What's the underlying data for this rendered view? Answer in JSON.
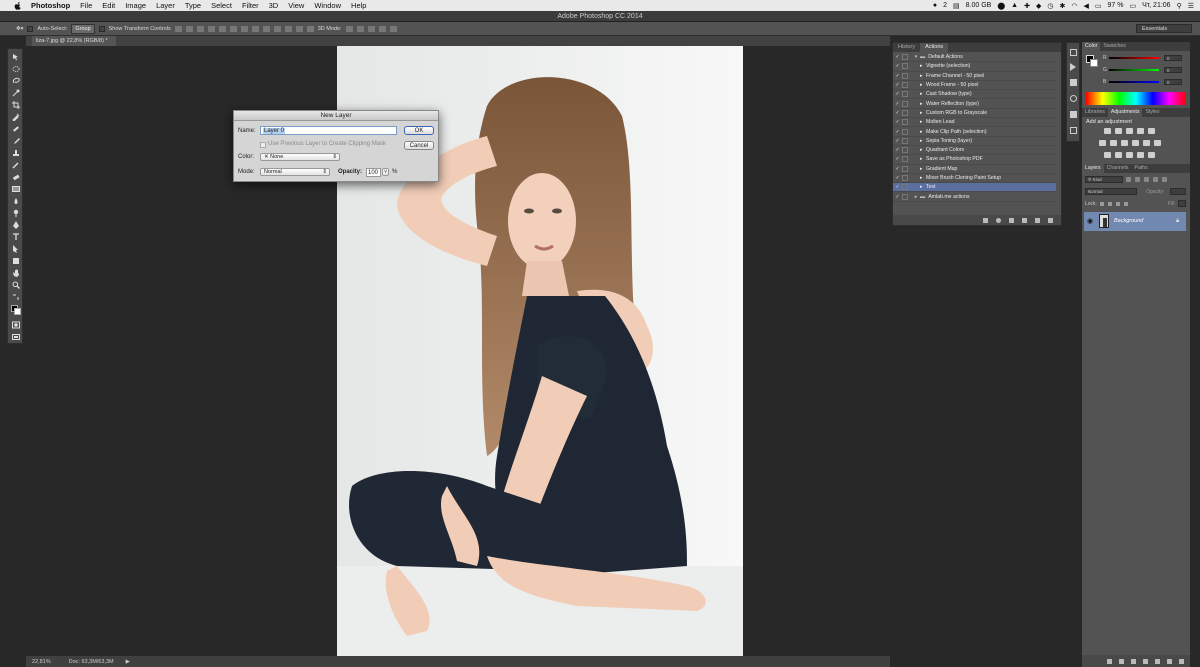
{
  "menubar": {
    "app": "Photoshop",
    "items": [
      "File",
      "Edit",
      "Image",
      "Layer",
      "Type",
      "Select",
      "Filter",
      "3D",
      "View",
      "Window",
      "Help"
    ],
    "status": {
      "notif": "2",
      "memory": "8.00 GB",
      "battery": "97 %",
      "clock": "Чт, 21:06"
    }
  },
  "window_title": "Adobe Photoshop CC 2014",
  "options_bar": {
    "auto_select_label": "Auto-Select:",
    "auto_select_value": "Group",
    "show_transform": "Show Transform Controls",
    "mode_3d": "3D Mode:",
    "workspace": "Essentials"
  },
  "document_tab": "liza-7.jpg @ 22,8% (RGB/8) *",
  "status_bar": {
    "zoom": "22,81%",
    "doc": "Doc: 63,3M/63,3M"
  },
  "dialog": {
    "title": "New Layer",
    "name_label": "Name:",
    "name_value": "Layer 0",
    "clip_label": "Use Previous Layer to Create Clipping Mask",
    "color_label": "Color:",
    "color_value": "None",
    "mode_label": "Mode:",
    "mode_value": "Normal",
    "opacity_label": "Opacity:",
    "opacity_value": "100",
    "opacity_unit": "%",
    "ok": "OK",
    "cancel": "Cancel"
  },
  "actions_panel": {
    "tabs": [
      "History",
      "Actions"
    ],
    "active_tab": "Actions",
    "rows": [
      {
        "label": "Default Actions",
        "folder": true,
        "open": true
      },
      {
        "label": "Vignette (selection)"
      },
      {
        "label": "Frame Channel - 50 pixel"
      },
      {
        "label": "Wood Frame - 50 pixel"
      },
      {
        "label": "Cast Shadow (type)"
      },
      {
        "label": "Water Reflection (type)"
      },
      {
        "label": "Custom RGB to Grayscale"
      },
      {
        "label": "Molten Lead"
      },
      {
        "label": "Make Clip Path (selection)"
      },
      {
        "label": "Sepia Toning (layer)"
      },
      {
        "label": "Quadrant Colors"
      },
      {
        "label": "Save as Photoshop PDF"
      },
      {
        "label": "Gradient Map"
      },
      {
        "label": "Mixer Brush Cloning Paint Setup"
      },
      {
        "label": "Test",
        "selected": true
      },
      {
        "label": "Amlab.me actions",
        "folder": true
      }
    ]
  },
  "color_panel": {
    "tabs": [
      "Color",
      "Swatches"
    ],
    "channels": [
      {
        "label": "R",
        "value": "0"
      },
      {
        "label": "G",
        "value": "0"
      },
      {
        "label": "B",
        "value": "0"
      }
    ]
  },
  "adjustments_panel": {
    "tabs": [
      "Libraries",
      "Adjustments",
      "Styles"
    ],
    "heading": "Add an adjustment"
  },
  "layers_panel": {
    "tabs": [
      "Layers",
      "Channels",
      "Paths"
    ],
    "kind_filter": "Kind",
    "blend_mode": "Normal",
    "opacity_label": "Opacity:",
    "lock_label": "Lock:",
    "fill_label": "Fill:",
    "layer_name": "Background"
  },
  "colors": {
    "accent": "#5a6fa0",
    "layer_selected": "#7189b0",
    "panel_bg": "#535353"
  }
}
